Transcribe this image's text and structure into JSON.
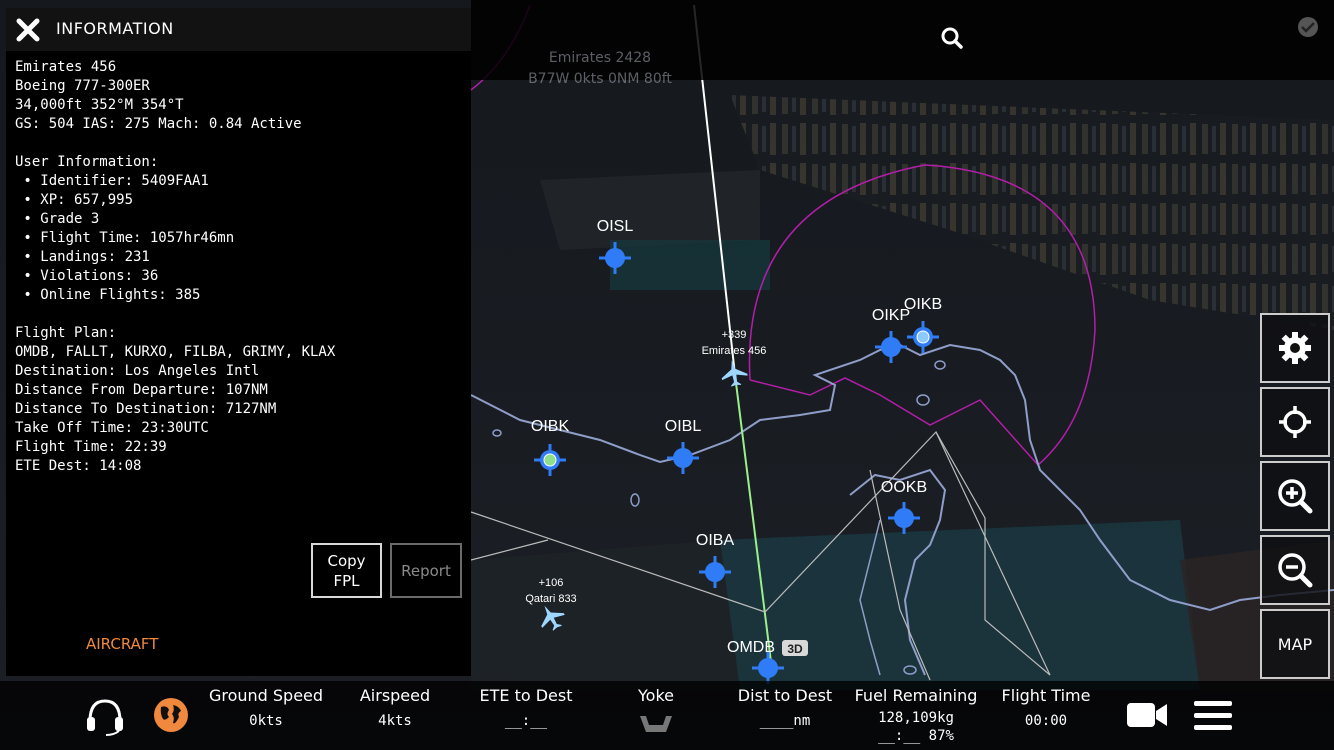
{
  "colors": {
    "accent_orange": "#f0883e",
    "waypoint_blue": "#2f7cf6",
    "route_green": "#9cf08a",
    "fir_purple": "#b21ea8",
    "coast": "#8f9ec9"
  },
  "top": {
    "ghost_callsign": "Emirates 2428",
    "ghost_info": "B77W 0kts 0NM 80ft",
    "search_icon": "search-icon",
    "check_icon": "check-icon"
  },
  "panel": {
    "title": "INFORMATION",
    "close_icon": "close-icon",
    "info_text": "Emirates 456\nBoeing 777-300ER\n34,000ft 352°M 354°T\nGS: 504 IAS: 275 Mach: 0.84 Active\n\nUser Information:\n • Identifier: 5409FAA1\n • XP: 657,995\n • Grade 3\n • Flight Time: 1057hr46mn\n • Landings: 231\n • Violations: 36\n • Online Flights: 385\n\nFlight Plan:\nOMDB, FALLT, KURXO, FILBA, GRIMY, KLAX\nDestination: Los Angeles Intl\nDistance From Departure: 107NM\nDistance To Destination: 7127NM\nTake Off Time: 23:30UTC\nFlight Time: 22:39\nETE Dest: 14:08",
    "copy_button": "Copy\nFPL",
    "report_button": "Report",
    "aircraft_link": "AIRCRAFT"
  },
  "map": {
    "waypoints": [
      {
        "name": "OISL",
        "kind": "blue"
      },
      {
        "name": "OIKP",
        "kind": "blue"
      },
      {
        "name": "OIKB",
        "kind": "light"
      },
      {
        "name": "OIBK",
        "kind": "green"
      },
      {
        "name": "OIBL",
        "kind": "blue"
      },
      {
        "name": "OIBA",
        "kind": "blue"
      },
      {
        "name": "OOKB",
        "kind": "blue"
      },
      {
        "name": "OMDB",
        "kind": "blue"
      }
    ],
    "badge_3d": "3D",
    "aircraft": [
      {
        "altitude": "+339",
        "callsign": "Emirates 456"
      },
      {
        "altitude": "+106",
        "callsign": "Qatari 833"
      }
    ]
  },
  "side_buttons": [
    {
      "name": "settings-button",
      "icon": "gear-icon"
    },
    {
      "name": "center-button",
      "icon": "crosshair-icon"
    },
    {
      "name": "zoom-in-button",
      "icon": "zoom-in-icon"
    },
    {
      "name": "zoom-out-button",
      "icon": "zoom-out-icon"
    },
    {
      "name": "map-button",
      "label": "MAP"
    }
  ],
  "bottom": {
    "stats": [
      {
        "label": "Ground Speed",
        "value": "0kts"
      },
      {
        "label": "Airspeed",
        "value": "4kts"
      },
      {
        "label": "ETE to Dest",
        "value": "__:__"
      },
      {
        "label": "Yoke",
        "value": ""
      },
      {
        "label": "Dist to Dest",
        "value": "____nm"
      },
      {
        "label": "Fuel Remaining",
        "value": "128,109kg",
        "value2": "__:__ 87%"
      },
      {
        "label": "Flight Time",
        "value": "00:00"
      }
    ],
    "icons": [
      "headset-icon",
      "globe-icon",
      "yoke-icon",
      "camera-icon",
      "menu-icon"
    ]
  }
}
